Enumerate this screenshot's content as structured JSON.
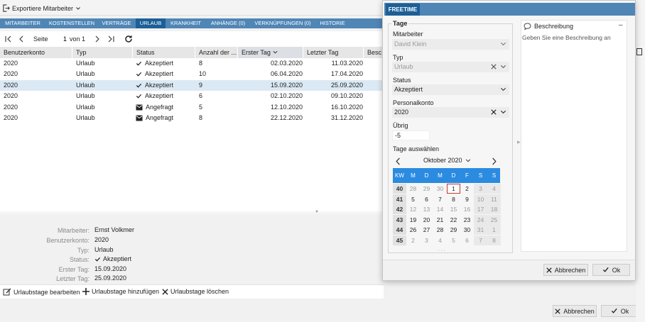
{
  "app": {
    "export_label": "Exportiere Mitarbeiter"
  },
  "tabs": [
    "MITARBEITER",
    "KOSTENSTELLEN",
    "VERTRÄGE",
    "URLAUB",
    "KRANKHEIT",
    "ANHÄNGE (0)",
    "VERKNÜPFUNGEN (0)",
    "HISTORIE"
  ],
  "active_tab": "URLAUB",
  "pager": {
    "page_label": "Seite",
    "page_value": "1",
    "of_label": "von 1"
  },
  "grid": {
    "columns": [
      "Benutzerkonto",
      "Typ",
      "Status",
      "Anzahl der ...",
      "Erster Tag",
      "Letzter Tag",
      "Besc"
    ],
    "sorted_column": "Erster Tag",
    "rows": [
      {
        "konto": "2020",
        "typ": "Urlaub",
        "status": "Akzeptiert",
        "status_icon": "check-icon",
        "anzahl": "8",
        "erster": "02.03.2020",
        "letzter": "11.03.2020",
        "selected": false
      },
      {
        "konto": "2020",
        "typ": "Urlaub",
        "status": "Akzeptiert",
        "status_icon": "check-icon",
        "anzahl": "10",
        "erster": "06.04.2020",
        "letzter": "17.04.2020",
        "selected": false
      },
      {
        "konto": "2020",
        "typ": "Urlaub",
        "status": "Akzeptiert",
        "status_icon": "check-icon",
        "anzahl": "9",
        "erster": "15.09.2020",
        "letzter": "25.09.2020",
        "selected": true
      },
      {
        "konto": "2020",
        "typ": "Urlaub",
        "status": "Akzeptiert",
        "status_icon": "check-icon",
        "anzahl": "6",
        "erster": "02.10.2020",
        "letzter": "09.10.2020",
        "selected": false
      },
      {
        "konto": "2020",
        "typ": "Urlaub",
        "status": "Angefragt",
        "status_icon": "mail-icon",
        "anzahl": "5",
        "erster": "12.10.2020",
        "letzter": "16.10.2020",
        "selected": false
      },
      {
        "konto": "2020",
        "typ": "Urlaub",
        "status": "Angefragt",
        "status_icon": "mail-icon",
        "anzahl": "8",
        "erster": "22.12.2020",
        "letzter": "31.12.2020",
        "selected": false
      }
    ]
  },
  "details": {
    "labels": {
      "mitarbeiter": "Mitarbeiter:",
      "konto": "Benutzerkonto:",
      "typ": "Typ:",
      "status": "Status:",
      "erster": "Erster Tag:",
      "letzter": "Letzter Tag:"
    },
    "values": {
      "mitarbeiter": "Ernst Volkmer",
      "konto": "2020",
      "typ": "Urlaub",
      "status": "Akzeptiert",
      "erster": "15.09.2020",
      "letzter": "25.09.2020"
    }
  },
  "actions": {
    "edit": "Urlaubstage bearbeiten",
    "add": "Urlaubstage hinzufügen",
    "delete": "Urlaubstage löschen"
  },
  "footer": {
    "cancel": "Abbrechen",
    "ok": "Ok"
  },
  "modal": {
    "tab": "FREETIME",
    "section_title": "Tage",
    "fields": {
      "mitarbeiter_label": "Mitarbeiter",
      "mitarbeiter_value": "David Klein",
      "typ_label": "Typ",
      "typ_value": "Urlaub",
      "status_label": "Status",
      "status_value": "Akzeptiert",
      "konto_label": "Personalkonto",
      "konto_value": "2020",
      "uebrig_label": "Übrig",
      "uebrig_value": "-5",
      "tage_label": "Tage auswählen"
    },
    "calendar": {
      "month_label": "Oktober 2020",
      "headers": [
        "KW",
        "M",
        "D",
        "M",
        "D",
        "F",
        "S",
        "S"
      ],
      "weeks": [
        {
          "kw": "40",
          "days": [
            "28",
            "29",
            "30",
            "1",
            "2",
            "3",
            "4"
          ],
          "dim": [
            true,
            true,
            true,
            false,
            false,
            true,
            true
          ],
          "today_index": 3
        },
        {
          "kw": "41",
          "days": [
            "5",
            "6",
            "7",
            "8",
            "9",
            "10",
            "11"
          ],
          "dim": [
            false,
            false,
            false,
            false,
            false,
            true,
            true
          ],
          "today_index": -1
        },
        {
          "kw": "42",
          "days": [
            "12",
            "13",
            "14",
            "15",
            "16",
            "17",
            "18"
          ],
          "dim": [
            true,
            true,
            true,
            true,
            true,
            true,
            true
          ],
          "today_index": -1
        },
        {
          "kw": "43",
          "days": [
            "19",
            "20",
            "21",
            "22",
            "23",
            "24",
            "25"
          ],
          "dim": [
            false,
            false,
            false,
            false,
            false,
            true,
            true
          ],
          "today_index": -1
        },
        {
          "kw": "44",
          "days": [
            "26",
            "27",
            "28",
            "29",
            "30",
            "31",
            "1"
          ],
          "dim": [
            false,
            false,
            false,
            false,
            false,
            true,
            true
          ],
          "today_index": -1
        },
        {
          "kw": "45",
          "days": [
            "2",
            "3",
            "4",
            "5",
            "6",
            "7",
            "8"
          ],
          "dim": [
            true,
            true,
            true,
            true,
            true,
            true,
            true
          ],
          "today_index": -1
        }
      ]
    },
    "description": {
      "title": "Beschreibung",
      "placeholder": "Geben Sie eine Beschreibung an"
    },
    "buttons": {
      "cancel": "Abbrechen",
      "ok": "Ok"
    }
  },
  "colors": {
    "tab_bar": "#4f86b6",
    "tab_active": "#1d5f97",
    "calendar_header": "#2b8be0",
    "selected_row": "#dbe9f4",
    "today_outline": "#c0392b"
  }
}
